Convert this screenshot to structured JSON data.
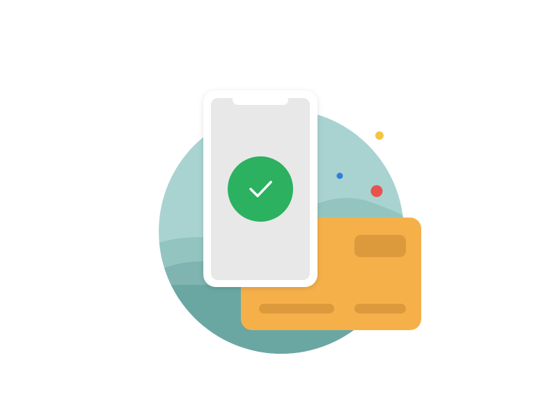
{
  "illustration": {
    "description_icon": "mobile-payment-success-icon",
    "colors": {
      "background": "#ffffff",
      "circle_light": "#a9d3d0",
      "hill_1": "#93c4c0",
      "hill_2": "#7fb4b0",
      "hill_3": "#6aa7a3",
      "phone_frame": "#ffffff",
      "phone_screen": "#e8e8e8",
      "check_badge": "#2bb160",
      "check_mark": "#ffffff",
      "card_body": "#f6b04a",
      "card_details": "#dc9a3c",
      "dot_yellow": "#f4c542",
      "dot_blue": "#2f7de1",
      "dot_red": "#e8524f"
    },
    "icons": {
      "phone": "smartphone-icon",
      "check": "check-icon",
      "card": "credit-card-icon"
    }
  }
}
